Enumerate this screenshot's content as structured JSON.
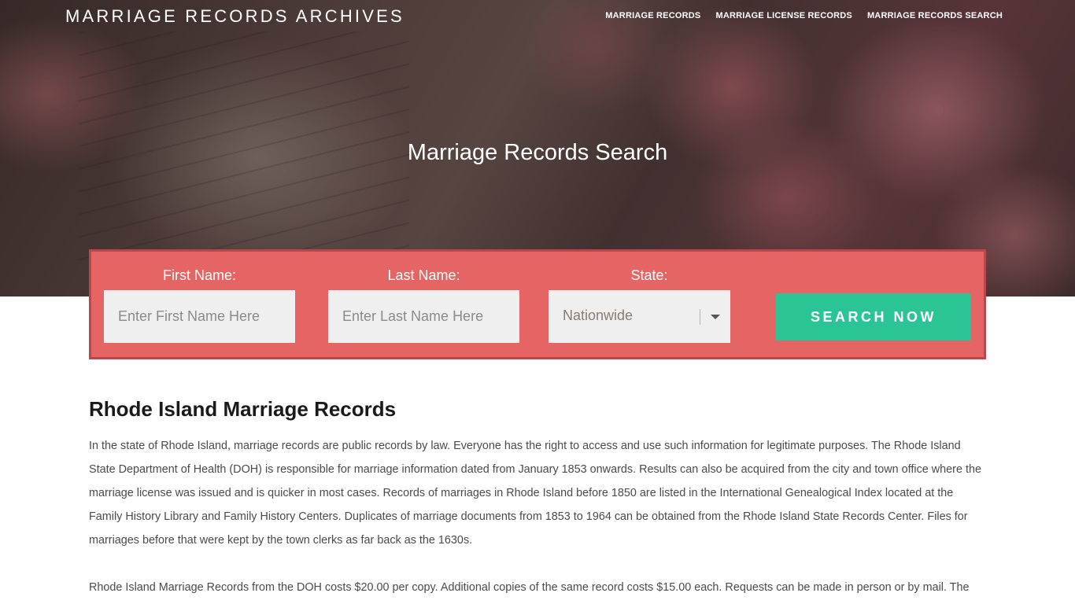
{
  "header": {
    "brand": "MARRIAGE RECORDS ARCHIVES",
    "nav": [
      {
        "label": "MARRIAGE RECORDS"
      },
      {
        "label": "MARRIAGE LICENSE RECORDS"
      },
      {
        "label": "MARRIAGE RECORDS SEARCH"
      }
    ]
  },
  "hero": {
    "title": "Marriage Records Search"
  },
  "search": {
    "first_name_label": "First Name:",
    "first_name_placeholder": "Enter First Name Here",
    "last_name_label": "Last Name:",
    "last_name_placeholder": "Enter Last Name Here",
    "state_label": "State:",
    "state_value": "Nationwide",
    "button_label": "SEARCH NOW"
  },
  "article": {
    "heading": "Rhode Island Marriage Records",
    "paragraph1": "In the state of Rhode Island, marriage records are public records by law. Everyone has the right to access and use such information for legitimate purposes. The Rhode Island State Department of Health (DOH) is responsible for marriage information dated from January 1853 onwards. Results can also be acquired from the city and town office where the marriage license was issued and is quicker in most cases. Records of marriages in Rhode Island before 1850 are listed in the International Genealogical Index located at the Family History Library and Family History Centers. Duplicates of marriage documents from 1853 to 1964 can be obtained from the Rhode Island State Records Center. Files for marriages before that were kept by the town clerks as far back as the 1630s.",
    "paragraph2": "Rhode Island Marriage Records from the DOH costs $20.00 per copy. Additional copies of the same record costs $15.00 each. Requests can be made in person or by mail. The"
  },
  "colors": {
    "panel": "#e46564",
    "panel_border": "#b8484b",
    "button": "#2bc495",
    "field": "#efefef"
  },
  "icons": {
    "state_dropdown": "chevron-down-icon"
  }
}
